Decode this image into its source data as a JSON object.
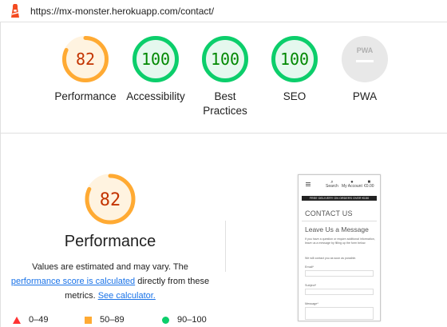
{
  "header": {
    "url": "https://mx-monster.herokuapp.com/contact/"
  },
  "colors": {
    "pass": "#0cce6b",
    "average": "#ffaa33",
    "fail": "#ff3333",
    "pass_text": "#008800",
    "average_text": "#c33300",
    "link": "#1a73e8"
  },
  "summary": [
    {
      "label": "Performance",
      "score": "82",
      "score_fraction": 0.82,
      "rating": "average"
    },
    {
      "label": "Accessibility",
      "score": "100",
      "score_fraction": 1.0,
      "rating": "pass"
    },
    {
      "label": "Best Practices",
      "score": "100",
      "score_fraction": 1.0,
      "rating": "pass"
    },
    {
      "label": "SEO",
      "score": "100",
      "score_fraction": 1.0,
      "rating": "pass"
    },
    {
      "label": "PWA",
      "score": "",
      "rating": "pwa",
      "icon": "pwa-badge-icon"
    }
  ],
  "performance": {
    "score": "82",
    "score_fraction": 0.82,
    "title": "Performance",
    "desc_1": "Values are estimated and may vary. The",
    "link_score": "performance score is calculated",
    "desc_2": "directly from these",
    "desc_3": "metrics.",
    "link_calc": "See calculator."
  },
  "legend": {
    "fail": "0–49",
    "average": "50–89",
    "pass": "90–100"
  },
  "screenshot": {
    "search": "Search",
    "account": "My Account",
    "cart": "€0.00",
    "banner": "FREE DELIVERY ON ORDERS OVER €150",
    "contact_title": "CONTACT US",
    "leave_title": "Leave Us a Message",
    "intro": "If you have a question or require additional information, leave us a message by filling up the form below.",
    "contact_soon": "We will contact you as soon as possible.",
    "email_label": "Email*",
    "subject_label": "Subject*",
    "message_label": "Message*"
  }
}
